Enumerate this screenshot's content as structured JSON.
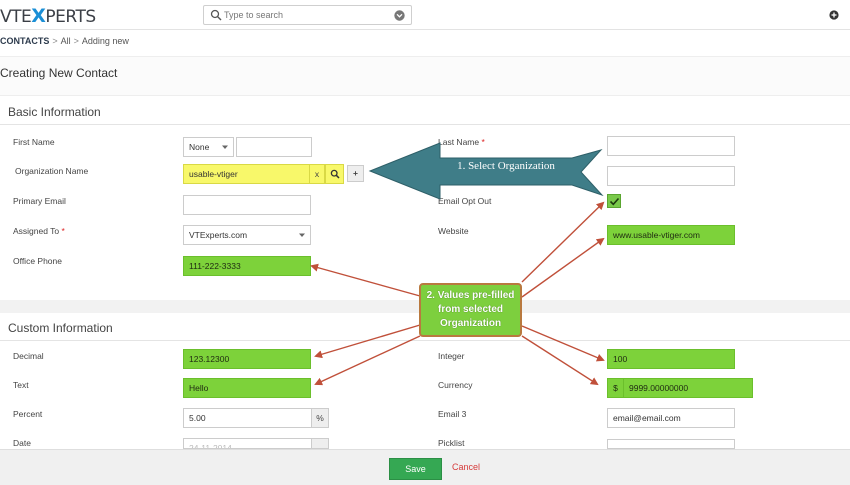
{
  "header": {
    "logo_prefix": "VTE",
    "logo_x": "X",
    "logo_suffix": "PERTS",
    "search_placeholder": "Type to search"
  },
  "breadcrumb": {
    "module": "CONTACTS",
    "sep": ">",
    "all": "All",
    "current": "Adding new"
  },
  "page_title": "Creating New Contact",
  "sections": {
    "basic": "Basic Information",
    "custom": "Custom Information"
  },
  "basic": {
    "first_name_label": "First Name",
    "salutation_value": "None",
    "last_name_label": "Last Name",
    "required_mark": "*",
    "org_label": "Organization Name",
    "org_value": "usable-vtiger",
    "org_clear": "x",
    "org_add": "+",
    "primary_email_label": "Primary Email",
    "email_opt_out_label": "Email Opt Out",
    "assigned_to_label": "Assigned To",
    "assigned_to_value": "VTExperts.com",
    "website_label": "Website",
    "website_value": "www.usable-vtiger.com",
    "office_phone_label": "Office Phone",
    "office_phone_value": "111-222-3333"
  },
  "custom": {
    "decimal_label": "Decimal",
    "decimal_value": "123.12300",
    "integer_label": "Integer",
    "integer_value": "100",
    "text_label": "Text",
    "text_value": "Hello",
    "currency_label": "Currency",
    "currency_symbol": "$",
    "currency_value": "9999.00000000",
    "percent_label": "Percent",
    "percent_value": "5.00",
    "percent_symbol": "%",
    "email3_label": "Email 3",
    "email3_value": "email@email.com",
    "date_label": "Date",
    "date_value": "24-11-2014",
    "picklist_label": "Picklist"
  },
  "footer": {
    "save_label": "Save",
    "cancel_label": "Cancel"
  },
  "annotations": {
    "step1": "1. Select Organization",
    "step2_line1": "2. Values pre-filled",
    "step2_line2": "from selected",
    "step2_line3": "Organization"
  },
  "colors": {
    "prefilled_green": "#7dd23a",
    "org_highlight_yellow": "#f8f86a",
    "save_green": "#35a853",
    "callout_teal": "#3f7d88",
    "arrow_red": "#c0503a"
  }
}
